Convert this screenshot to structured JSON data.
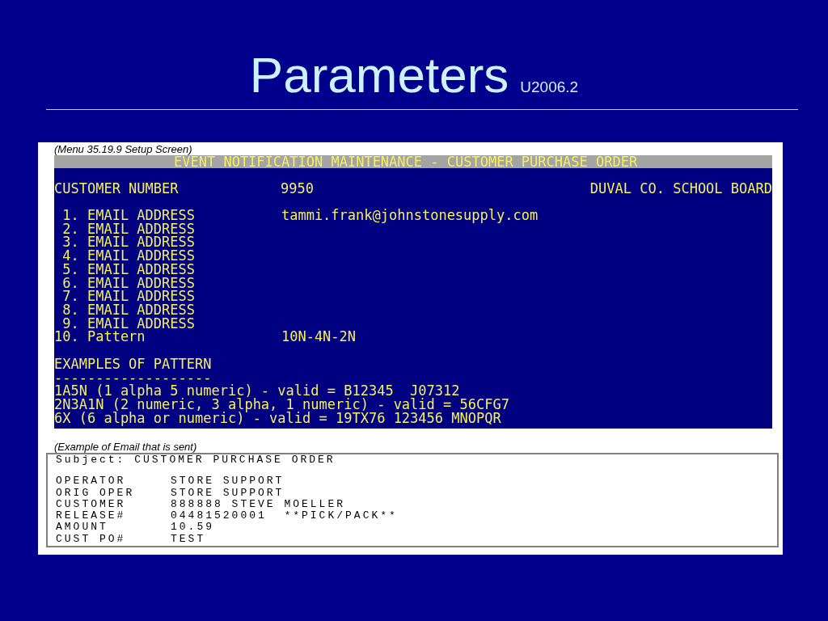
{
  "slide": {
    "title": "Parameters",
    "version": "U2006.2"
  },
  "setup_screen": {
    "caption": "(Menu 35.19.9 Setup Screen)",
    "header": "EVENT NOTIFICATION MAINTENANCE - CUSTOMER PURCHASE ORDER",
    "customer": {
      "label": "CUSTOMER NUMBER",
      "number": "9950",
      "name": "DUVAL CO. SCHOOL BOARD"
    },
    "fields": [
      {
        "number": "1.",
        "label": "EMAIL ADDRESS",
        "value": "tammi.frank@johnstonesupply.com"
      },
      {
        "number": "2.",
        "label": "EMAIL ADDRESS"
      },
      {
        "number": "3.",
        "label": "EMAIL ADDRESS"
      },
      {
        "number": "4.",
        "label": "EMAIL ADDRESS"
      },
      {
        "number": "5.",
        "label": "EMAIL ADDRESS"
      },
      {
        "number": "6.",
        "label": "EMAIL ADDRESS"
      },
      {
        "number": "7.",
        "label": "EMAIL ADDRESS"
      },
      {
        "number": "8.",
        "label": "EMAIL ADDRESS"
      },
      {
        "number": "9.",
        "label": "EMAIL ADDRESS"
      },
      {
        "number": "10.",
        "label": "Pattern",
        "value": "10N-4N-2N"
      }
    ],
    "examples_heading": "EXAMPLES OF PATTERN",
    "examples_rule": "-------------------",
    "examples": [
      "1A5N (1 alpha 5 numeric) - valid = B12345  J07312",
      "2N3A1N (2 numeric, 3 alpha, 1 numeric) - valid = 56CFG7",
      "6X (6 alpha or numeric) - valid = 19TX76 123456 MNOPQR"
    ]
  },
  "email_example": {
    "caption": "(Example of Email that is sent)",
    "subject": "Subject: CUSTOMER PURCHASE ORDER",
    "rows": [
      {
        "label": "OPERATOR",
        "value": "STORE SUPPORT"
      },
      {
        "label": "ORIG OPER",
        "value": "STORE SUPPORT"
      },
      {
        "label": "CUSTOMER",
        "value": "888888 STEVE MOELLER"
      },
      {
        "label": "RELEASE#",
        "value": "04481520001  **PICK/PACK**"
      },
      {
        "label": "AMOUNT",
        "value": "10.59"
      },
      {
        "label": "CUST PO#",
        "value": "TEST"
      }
    ]
  }
}
